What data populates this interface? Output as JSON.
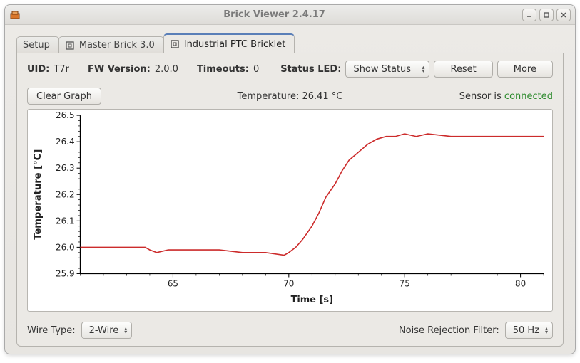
{
  "window": {
    "title": "Brick Viewer 2.4.17"
  },
  "tabs": {
    "setup": "Setup",
    "master": "Master Brick 3.0",
    "ptc": "Industrial PTC Bricklet"
  },
  "info": {
    "uid_label": "UID:",
    "uid_value": "T7r",
    "fw_label": "FW Version:",
    "fw_value": "2.0.0",
    "timeouts_label": "Timeouts:",
    "timeouts_value": "0",
    "status_led_label": "Status LED:",
    "status_led_value": "Show Status",
    "reset_label": "Reset",
    "more_label": "More"
  },
  "status": {
    "clear_label": "Clear Graph",
    "temperature_label": "Temperature: 26.41 °C",
    "sensor_prefix": "Sensor is ",
    "sensor_state": "connected"
  },
  "bottom": {
    "wire_type_label": "Wire Type:",
    "wire_type_value": "2-Wire",
    "noise_label": "Noise Rejection Filter:",
    "noise_value": "50 Hz"
  },
  "chart_data": {
    "type": "line",
    "title": "Temperature: 26.41 °C",
    "xlabel": "Time [s]",
    "ylabel": "Temperature [°C]",
    "xlim": [
      61,
      81
    ],
    "ylim": [
      25.9,
      26.5
    ],
    "x_ticks": [
      65,
      70,
      75,
      80
    ],
    "y_ticks": [
      25.9,
      26.0,
      26.1,
      26.2,
      26.3,
      26.4,
      26.5
    ],
    "series": [
      {
        "name": "Temperature",
        "color": "#cc2b2b",
        "x": [
          61.0,
          62.0,
          63.0,
          63.8,
          64.0,
          64.3,
          64.8,
          65.5,
          66.0,
          67.0,
          68.0,
          69.0,
          69.8,
          70.0,
          70.3,
          70.6,
          71.0,
          71.3,
          71.6,
          72.0,
          72.3,
          72.6,
          73.0,
          73.4,
          73.8,
          74.2,
          74.6,
          75.0,
          75.5,
          76.0,
          77.0,
          78.0,
          79.0,
          80.0,
          81.0
        ],
        "values": [
          26.0,
          26.0,
          26.0,
          26.0,
          25.99,
          25.98,
          25.99,
          25.99,
          25.99,
          25.99,
          25.98,
          25.98,
          25.97,
          25.98,
          26.0,
          26.03,
          26.08,
          26.13,
          26.19,
          26.24,
          26.29,
          26.33,
          26.36,
          26.39,
          26.41,
          26.42,
          26.42,
          26.43,
          26.42,
          26.43,
          26.42,
          26.42,
          26.42,
          26.42,
          26.42
        ]
      }
    ]
  }
}
